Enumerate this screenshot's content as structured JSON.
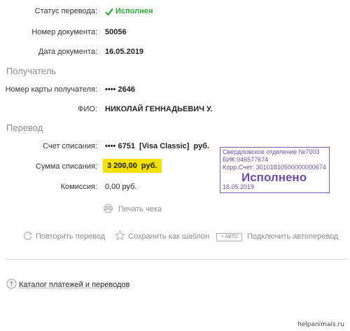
{
  "status": {
    "label": "Статус перевода:",
    "value": "Исполнен"
  },
  "doc_number": {
    "label": "Номер документа:",
    "value": "50056"
  },
  "doc_date": {
    "label": "Дата документа:",
    "value": "16.05.2019"
  },
  "recipient_section": "Получатель",
  "card_number": {
    "label": "Номер карты получателя:",
    "value": "•••• 2646"
  },
  "fio": {
    "label": "ФИО:",
    "value": "НИКОЛАЙ ГЕННАДЬЕВИЧ У."
  },
  "transfer_section": "Перевод",
  "debit_account": {
    "label": "Счет списания:",
    "value": "•••• 6751  [Visa Classic]  руб."
  },
  "debit_amount": {
    "label": "Сумма списания:",
    "value": "3 200,00  руб."
  },
  "commission": {
    "label": "Комиссия:",
    "value": "0,00 руб."
  },
  "stamp": {
    "line1": "Свердловское отделение №7003",
    "line2": "БИК:046577674",
    "line3": "Корр.Счет: 30101810500000000674",
    "big": "Исполнено",
    "date": "16.05.2019"
  },
  "actions": {
    "print": "Печать чека",
    "repeat": "Повторить перевод",
    "save_template": "Сохранить как шаблон",
    "auto_badge": "+ АВТО",
    "autopay": "Подключить автоперевод"
  },
  "catalog_link": "Каталог платежей и переводов",
  "watermark": "helpanimals.ru",
  "colors": {
    "success": "#2ea43a",
    "highlight": "#f5e100",
    "stamp": "#6a4ea0"
  }
}
